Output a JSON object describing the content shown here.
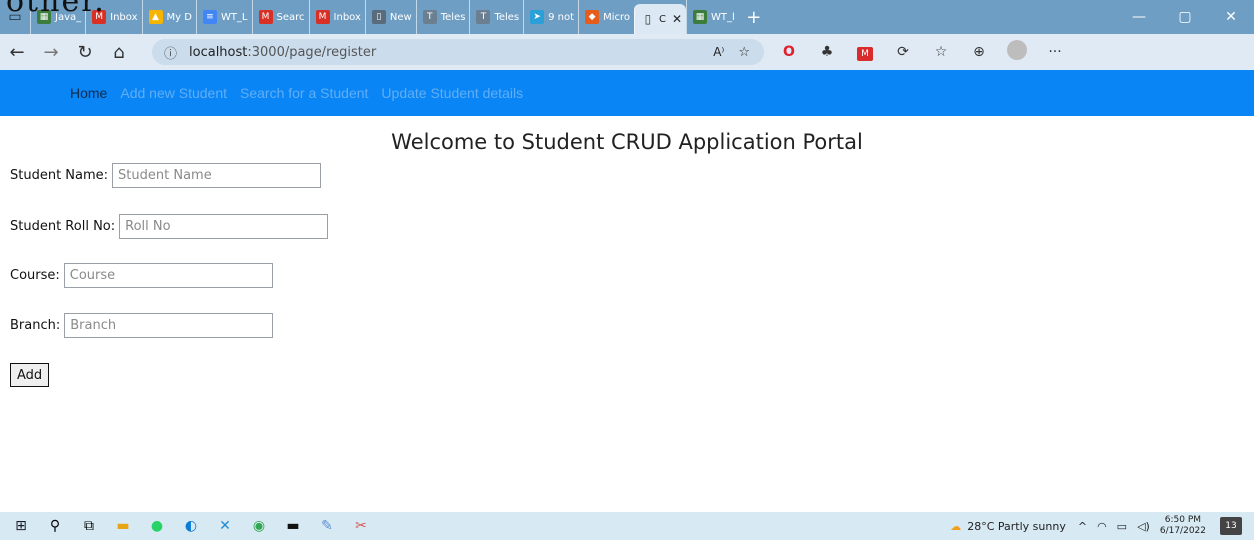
{
  "stray_text": "other.",
  "browser": {
    "tabs": [
      {
        "label": "Java_",
        "icon": "sheet-icon",
        "color": "#3c7d3e",
        "glyph": "▦"
      },
      {
        "label": "Inbox",
        "icon": "gmail-icon",
        "color": "#d93025",
        "glyph": "M"
      },
      {
        "label": "My D",
        "icon": "drive-icon",
        "color": "#f4b400",
        "glyph": "▲"
      },
      {
        "label": "WT_L",
        "icon": "docs-icon",
        "color": "#4285f4",
        "glyph": "≡"
      },
      {
        "label": "Searc",
        "icon": "gmail-icon",
        "color": "#d93025",
        "glyph": "M"
      },
      {
        "label": "Inbox",
        "icon": "gmail-icon",
        "color": "#d93025",
        "glyph": "M"
      },
      {
        "label": "New",
        "icon": "page-icon",
        "color": "#5a6b7c",
        "glyph": "▯"
      },
      {
        "label": "Teles",
        "icon": "tu-icon",
        "color": "#6b7f90",
        "glyph": "T"
      },
      {
        "label": "Teles",
        "icon": "tu-icon",
        "color": "#6b7f90",
        "glyph": "T"
      },
      {
        "label": "9 not",
        "icon": "telegram-icon",
        "color": "#2a9fd8",
        "glyph": "➤"
      },
      {
        "label": "Micro",
        "icon": "office-icon",
        "color": "#e65c1b",
        "glyph": "◆"
      }
    ],
    "active_tab": {
      "label": "C",
      "icon": "page-icon"
    },
    "after_tab": {
      "label": "WT_l",
      "icon": "sheet-icon",
      "color": "#3c7d3e",
      "glyph": "▦"
    },
    "new_tab_glyph": "+",
    "url_host": "localhost",
    "url_path": ":3000/page/register"
  },
  "nav": {
    "home": "Home",
    "items": [
      "Add new Student",
      "Search for a Student",
      "Update Student details"
    ]
  },
  "page": {
    "title": "Welcome to Student CRUD Application Portal",
    "fields": [
      {
        "label": "Student Name:",
        "placeholder": "Student Name"
      },
      {
        "label": "Student Roll No:",
        "placeholder": "Roll No"
      },
      {
        "label": "Course:",
        "placeholder": "Course"
      },
      {
        "label": "Branch:",
        "placeholder": "Branch"
      }
    ],
    "add_button": "Add"
  },
  "taskbar": {
    "weather": "28°C  Partly sunny",
    "time": "6:50 PM",
    "date": "6/17/2022",
    "notifications": "13"
  },
  "colors": {
    "navbar": "#0a85f5",
    "tabstrip": "#6e9ec4",
    "addressbar": "#dfeaf4",
    "taskbar": "#d7e9f2"
  }
}
